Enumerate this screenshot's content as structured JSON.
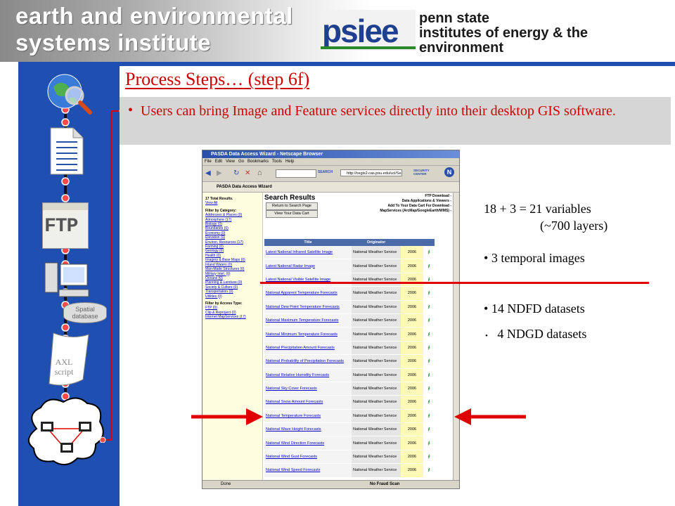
{
  "header": {
    "institute_line1": "earth and environmental",
    "institute_line2": "systems institute",
    "psiee_logo_text": "psiee",
    "penn_line1": "penn state",
    "penn_line2": "institutes of energy & the environment"
  },
  "slide": {
    "title": "Process Steps… (step 6f)",
    "bullet": "Users can bring Image and Feature services directly into their desktop GIS software."
  },
  "workflow": {
    "ftp_label": "FTP",
    "spatial_db_label": "Spatial database",
    "axl_label": "AXL script"
  },
  "browser": {
    "window_title": "PASDA Data Access Wizard - Netscape Browser",
    "menu": [
      "File",
      "Edit",
      "View",
      "Go",
      "Bookmarks",
      "Tools",
      "Help"
    ],
    "search_label": "SEARCH",
    "url": "http://cegis2.cas.psu.edu/uci/Se",
    "security_label": "SECURITY CENTER",
    "tab_label": "PASDA Data Access Wizard",
    "search_results_heading": "Search Results",
    "btn_return": "Return to Search Page",
    "btn_cart": "View Your Data Cart",
    "legend": [
      "FTP Download -",
      "Data Applications & Viewers -",
      "Add To Your Data Cart For Download -",
      "MapServices (ArcMap/GoogleEarth/WMS) -"
    ],
    "sidebar": {
      "total": "17 Total Results.",
      "view_all": "View All",
      "filter_category": "Filter by Category:",
      "categories": [
        "Addresses & Places (0)",
        "Atmosphere (17)",
        "Biology (0)",
        "Boundaries (0)",
        "Economy (0)",
        "Elevation (0)",
        "Environ. Resources (17)",
        "Farming (0)",
        "Geology (0)",
        "Health (0)",
        "Imagery & Base Maps (0)",
        "Inland Waters (0)",
        "Man-Made Structures (0)",
        "Military Intel. (0)",
        "Oceans (0)",
        "Planning & Landuse (0)",
        "Society & Culture (0)",
        "Transportation (0)",
        "Utilities (0)"
      ],
      "filter_access": "Filter by Access Type:",
      "access": [
        "FTP (0)",
        "Clip & Reproject (0)",
        "Internet MapServices (17)"
      ]
    },
    "table_headers": [
      "Title",
      "Originator"
    ],
    "rows": [
      {
        "title": "Latest National Infrared Satellite Image",
        "originator": "National Weather Service",
        "year": "2006"
      },
      {
        "title": "Latest National Radar Image",
        "originator": "National Weather Service",
        "year": "2006"
      },
      {
        "title": "Latest National Visible Satellite Image",
        "originator": "National Weather Service",
        "year": "2006"
      },
      {
        "title": "National Apparent Temperature Forecasts",
        "originator": "National Weather Service",
        "year": "2006"
      },
      {
        "title": "National Dew Point Temperature Forecasts",
        "originator": "National Weather Service",
        "year": "2006"
      },
      {
        "title": "National Maximum Temperature Forecasts",
        "originator": "National Weather Service",
        "year": "2006"
      },
      {
        "title": "National Minimum Temperature Forecasts",
        "originator": "National Weather Service",
        "year": "2006"
      },
      {
        "title": "National Precipitation Amount Forecasts",
        "originator": "National Weather Service",
        "year": "2006"
      },
      {
        "title": "National Probability of Precipitation Forecasts",
        "originator": "National Weather Service",
        "year": "2006"
      },
      {
        "title": "National Relative Humidity Forecasts",
        "originator": "National Weather Service",
        "year": "2006"
      },
      {
        "title": "National Sky Cover Forecasts",
        "originator": "National Weather Service",
        "year": "2006"
      },
      {
        "title": "National Snow Amount Forecasts",
        "originator": "National Weather Service",
        "year": "2006"
      },
      {
        "title": "National Temperature Forecasts",
        "originator": "National Weather Service",
        "year": "2006"
      },
      {
        "title": "National Wave Height Forecasts",
        "originator": "National Weather Service",
        "year": "2006"
      },
      {
        "title": "National Wind Direction Forecasts",
        "originator": "National Weather Service",
        "year": "2006"
      },
      {
        "title": "National Wind Gust Forecasts",
        "originator": "National Weather Service",
        "year": "2006"
      },
      {
        "title": "National Wind Speed Forecasts",
        "originator": "National Weather Service",
        "year": "2006"
      }
    ],
    "status_done": "Done",
    "status_fraud": "No Fraud Scan"
  },
  "notes": {
    "variables": "18 + 3 = 21 variables",
    "layers": "(~700 layers)",
    "temporal": "3 temporal images",
    "ndfd": "14 NDFD datasets",
    "ndgd": "4 NDGD datasets"
  },
  "colors": {
    "accent_red": "#cc0000",
    "arrow_red": "#e10000",
    "left_column_blue": "#1f4fb0",
    "bullet_band_gray": "#d6d6d6"
  }
}
